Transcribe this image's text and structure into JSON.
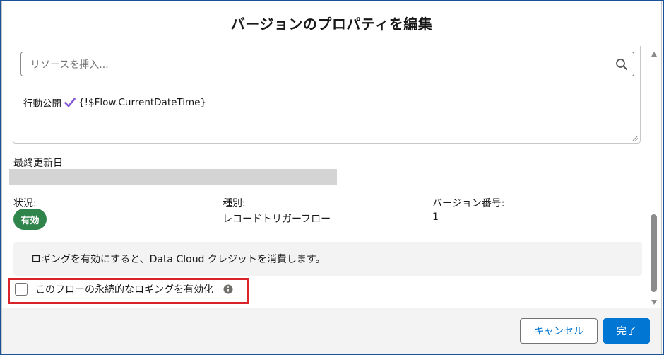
{
  "modal": {
    "title": "バージョンのプロパティを編集"
  },
  "editor": {
    "search_placeholder": "リソースを挿入...",
    "text_prefix": "行動公開",
    "text_formula": "{!$Flow.CurrentDateTime}"
  },
  "fields": {
    "last_modified_label": "最終更新日",
    "status_label": "状況:",
    "status_value": "有効",
    "type_label": "種別:",
    "type_value": "レコードトリガーフロー",
    "version_label": "バージョン番号:",
    "version_value": "1"
  },
  "notice": {
    "text": "ロギングを有効にすると、Data Cloud クレジットを消費します。"
  },
  "logging": {
    "checkbox_label": "このフローの永続的なロギングを有効化",
    "checked": false
  },
  "footer": {
    "cancel_label": "キャンセル",
    "done_label": "完了"
  },
  "colors": {
    "brand_blue": "#0176d3",
    "success_green": "#2e844a",
    "highlight_red": "#d8232a",
    "check_purple": "#7f56d9"
  },
  "icons": [
    "search-icon",
    "check-icon",
    "info-icon",
    "resize-grip-icon"
  ]
}
